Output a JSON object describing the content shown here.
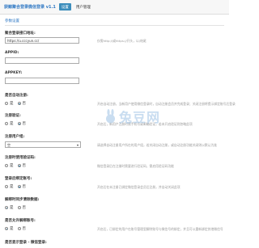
{
  "header": {
    "title": "获鲸聚合登录微信登录 v1.1",
    "tabs": [
      {
        "label": "设置",
        "active": true
      },
      {
        "label": "用户管理",
        "active": false
      }
    ]
  },
  "section": {
    "title": "参数设置"
  },
  "fields": {
    "api_address": {
      "label": "聚合登录接口地址:",
      "value": "https://u.cccyun.cc/",
      "hint": "仅需http://或https://开头，以/结尾"
    },
    "appid": {
      "label": "APPID:",
      "value": ""
    },
    "appkey": {
      "label": "APPKEY:",
      "value": ""
    },
    "auto_register": {
      "label": "是否自动注册:",
      "options": [
        "是",
        "否"
      ],
      "selected": "否",
      "hint": "开启自动注册，当新用户使用微信登录时，自动注册会员并完成登录；关闭注册将提示绑定账号后登录"
    },
    "register_verify": {
      "label": "注册验证:",
      "options": [
        "是",
        "否"
      ],
      "selected": "否",
      "hint": "开启后，新用户注册时需手机号或邮箱验证，若未开启验证则忽略此项"
    },
    "register_user_group": {
      "label": "注册用户组:",
      "value": "空",
      "hint": "请选择自动注册用户所在的用户组，若关闭自动注册，或自动注册功能关闭则以默认为准"
    },
    "login_bind": {
      "label": "注册时使用验证码:",
      "options": [
        "是",
        "否"
      ],
      "selected": "否",
      "hint": "微信登录后在注册时需要进行验证码，需启用验证码功能"
    },
    "unbind": {
      "label": "登录后绑定账号:",
      "options": [
        "是",
        "否"
      ],
      "selected": "否",
      "hint": "开启后在未注册已绑定微信登录会员后注册，并自动关闭此项"
    },
    "unbind_clear": {
      "label": "解绑时同步清除数据:",
      "options": [
        "是",
        "否"
      ],
      "selected": "是"
    },
    "allow_unbind": {
      "label": "是否允许解绑账号:",
      "options": [
        "是",
        "否"
      ],
      "selected": "是",
      "hint": "开启后，已绑定的用户在账号管理里解除账号与微信号的绑定，并且可以重新绑定其他微信号"
    },
    "return_login": {
      "label": "是否显示登录 - 微信登录:"
    }
  },
  "watermark": {
    "text": "兔豆网"
  },
  "colors": {
    "accent": "#3c8dbc",
    "title": "#2f78c4",
    "hint": "#999999"
  }
}
